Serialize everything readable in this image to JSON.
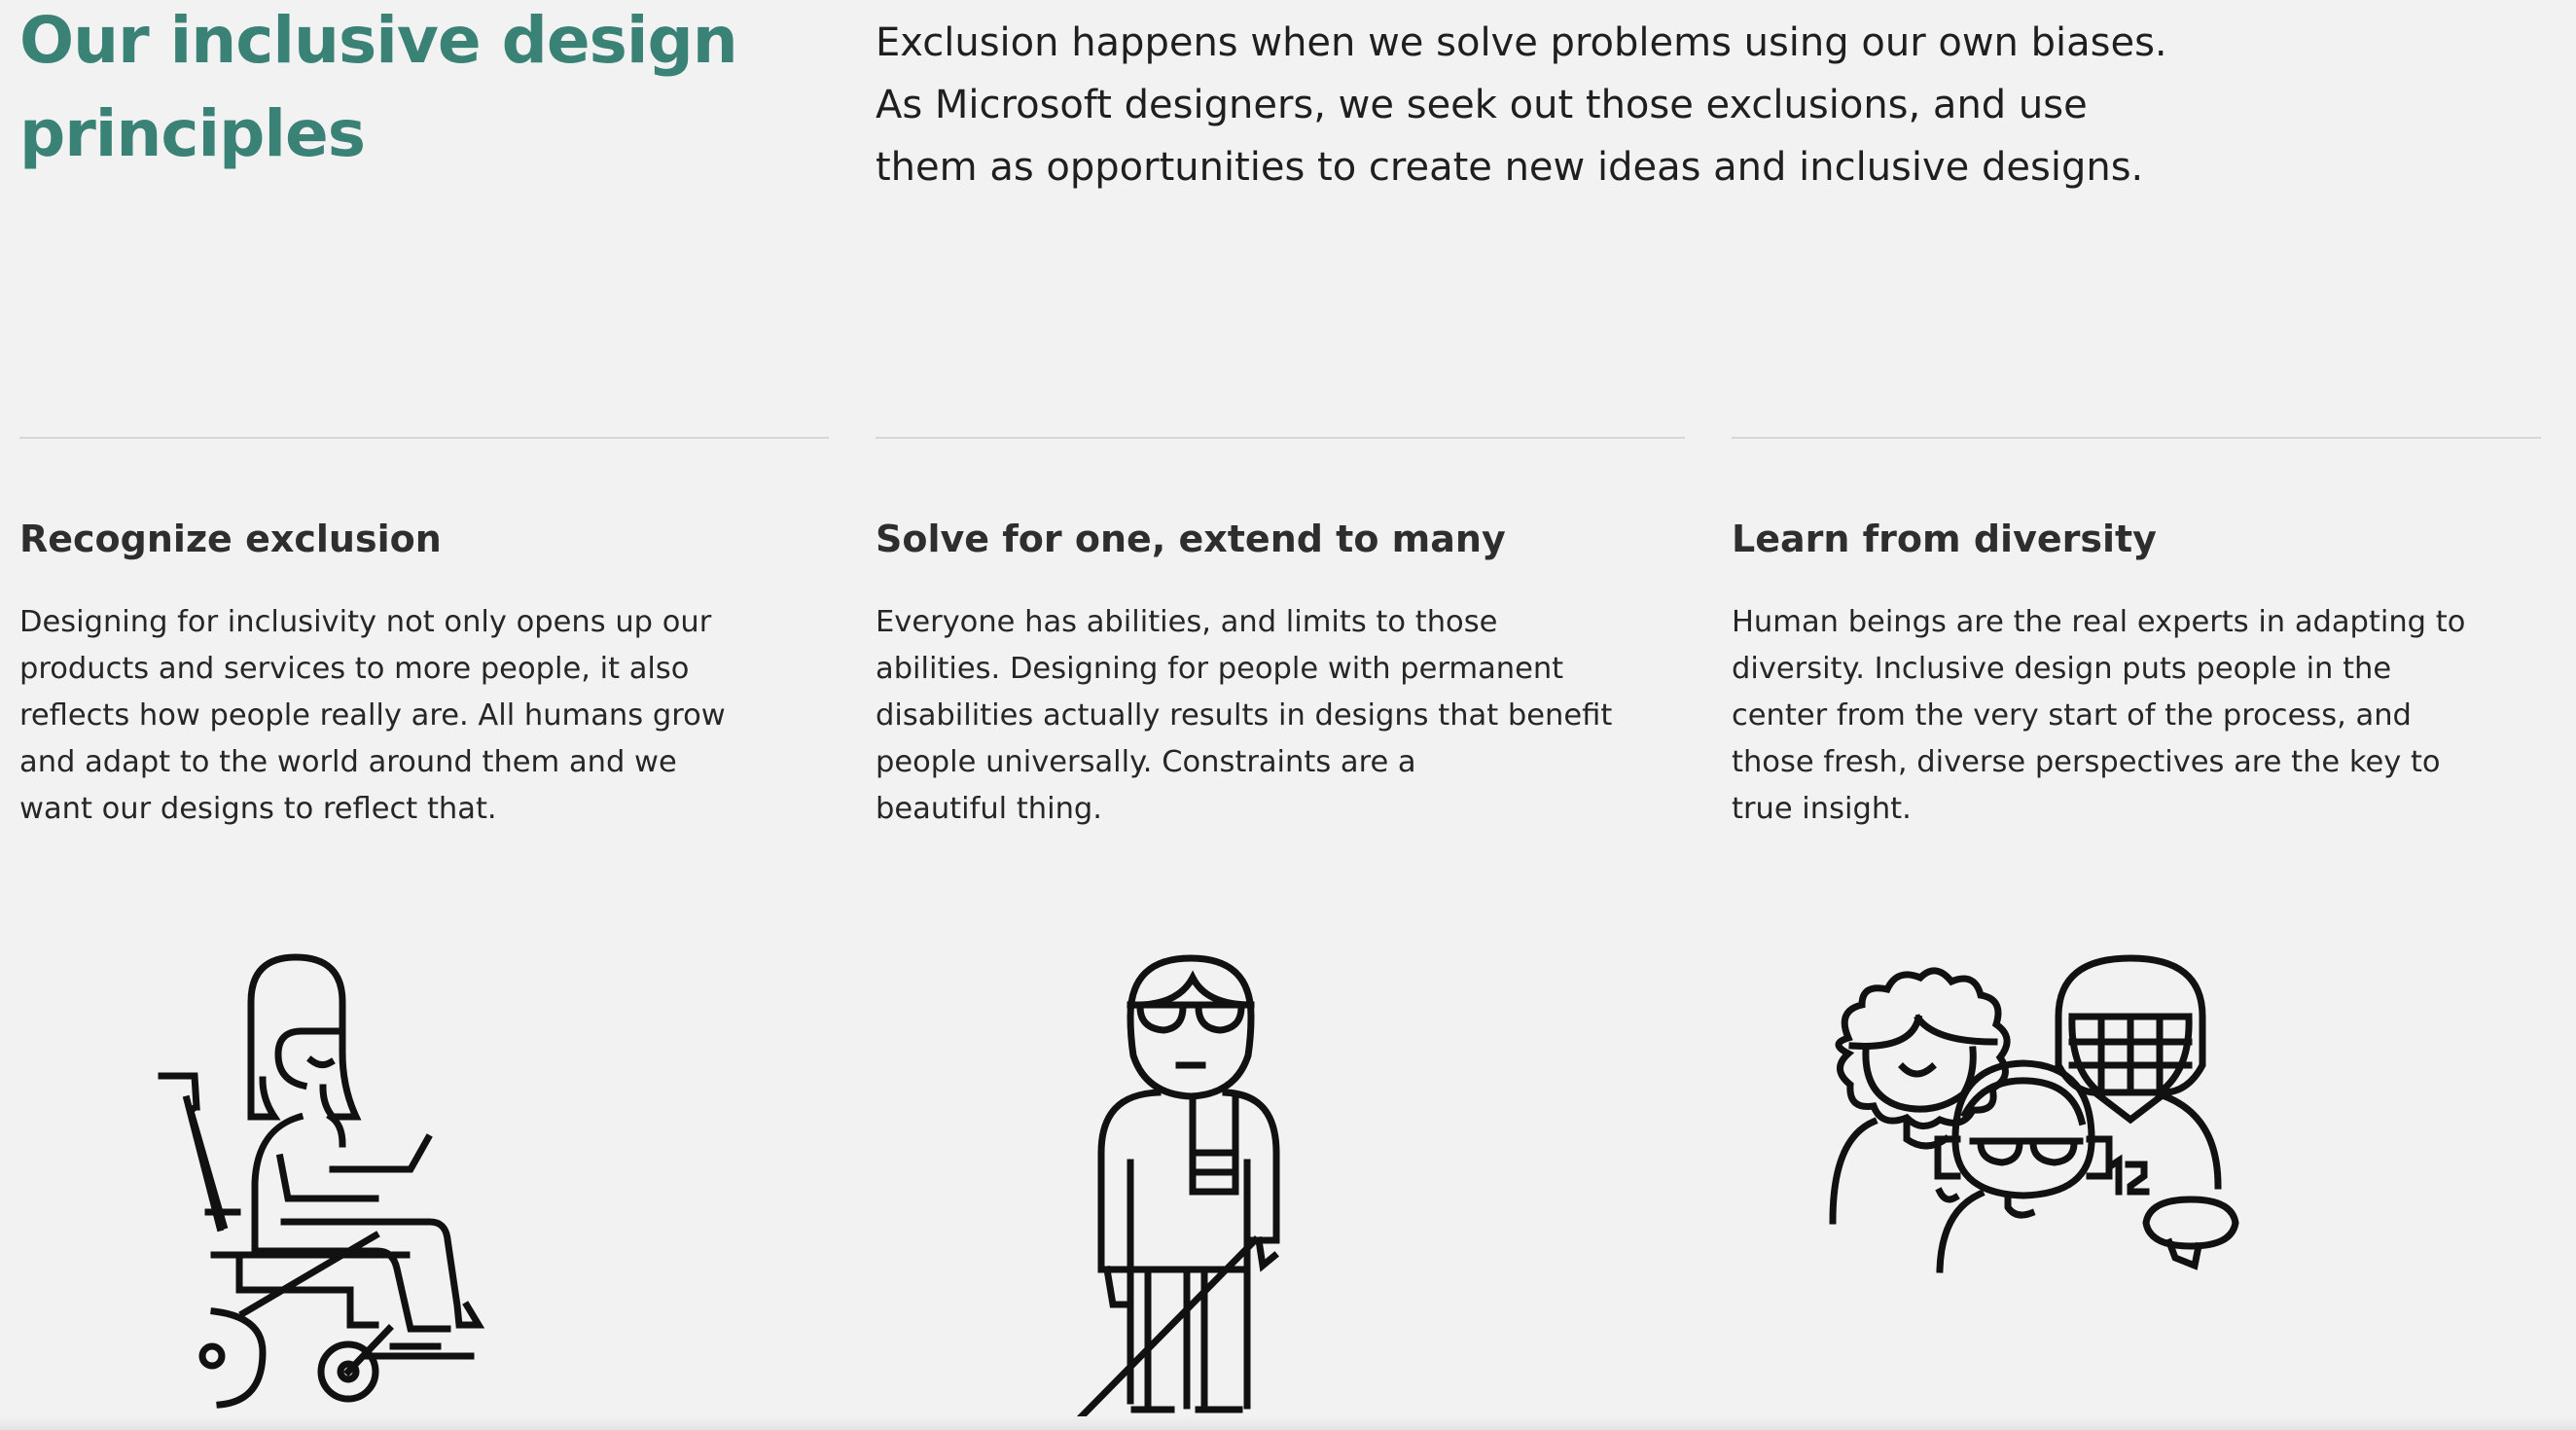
{
  "header": {
    "title_line1": "Our inclusive design",
    "title_line2": "principles",
    "intro_line1": "Exclusion happens when we solve problems using our own biases.",
    "intro_line2": "As Microsoft designers, we seek out those exclusions, and use",
    "intro_line3": "them as opportunities to create new ideas and inclusive designs.",
    "accent_color": "#3a8275"
  },
  "principles": [
    {
      "heading": "Recognize exclusion",
      "lines": [
        "Designing for inclusivity not only opens up our",
        "products and services to more people, it also",
        "reflects how people really are. All humans grow",
        "and adapt to the world around them and we",
        "want our designs to reflect that."
      ],
      "illustration": "person-in-wheelchair-with-laptop-icon"
    },
    {
      "heading": "Solve for one, extend to many",
      "lines": [
        "Everyone has abilities, and limits to those",
        "abilities. Designing for people with permanent",
        "disabilities actually results in designs that benefit",
        "people universally. Constraints are a",
        "beautiful thing."
      ],
      "illustration": "person-with-white-cane-icon"
    },
    {
      "heading": "Learn from diversity",
      "lines": [
        "Human beings are the real experts in adapting to",
        "diversity. Inclusive design puts people in the",
        "center from the very start of the process, and",
        "those fresh, diverse perspectives are the key to",
        "true insight."
      ],
      "illustration": "diverse-group-of-people-icon",
      "jersey_number": "12"
    }
  ]
}
